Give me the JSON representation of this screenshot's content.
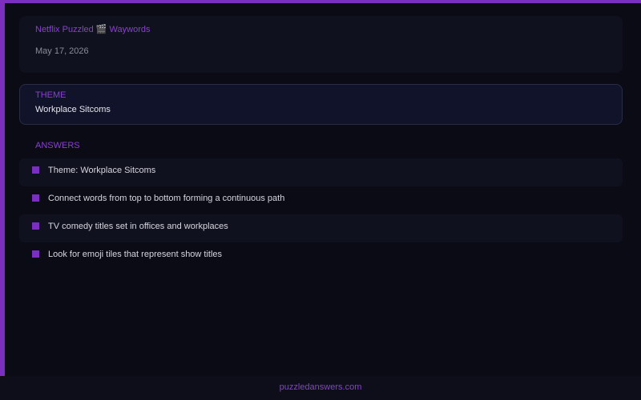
{
  "colors": {
    "accent": "#7a2fc0",
    "accent_text": "#8a3fd4",
    "background": "#0a0b14",
    "card": "#10111e"
  },
  "header": {
    "breadcrumb": "Netflix Puzzled 🎬 Waywords",
    "date": "May 17, 2026"
  },
  "theme": {
    "label": "THEME",
    "value": "Workplace Sitcoms"
  },
  "answers": {
    "heading": "ANSWERS",
    "items": [
      "Theme: Workplace Sitcoms",
      "Connect words from top to bottom forming a continuous path",
      "TV comedy titles set in offices and workplaces",
      "Look for emoji tiles that represent show titles"
    ]
  },
  "footer": {
    "link": "puzzledanswers.com"
  }
}
